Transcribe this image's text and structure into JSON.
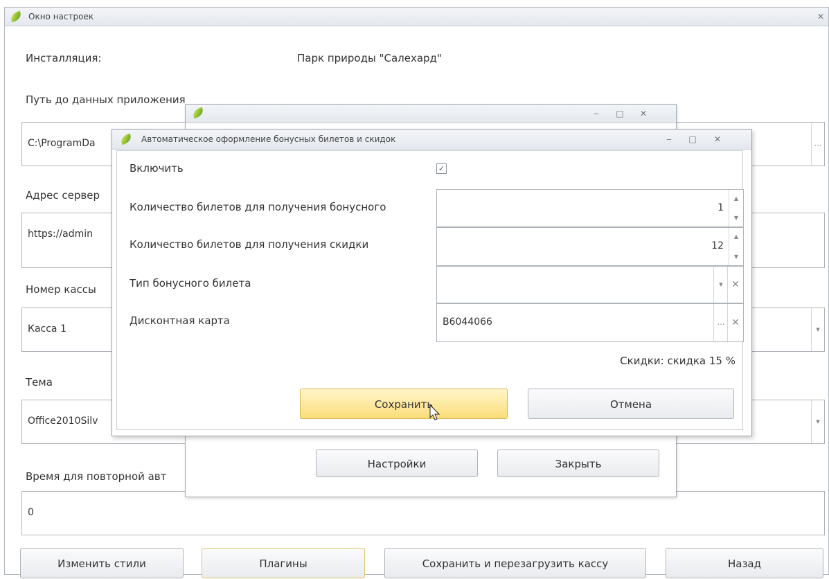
{
  "colors": {
    "accent": "#2b4fd6",
    "hot_button": "#fbdc7a",
    "border": "#aeb3ba"
  },
  "main": {
    "title": "Окно настроек",
    "installation_label": "Инсталляция:",
    "installation_value": "Парк природы \"Салехард\"",
    "path_label": "Путь до данных приложения",
    "path_value": "C:\\ProgramDa",
    "server_label": "Адрес сервер",
    "server_value": "https://admin",
    "register_label": "Номер кассы",
    "register_value": "Касса 1",
    "theme_label": "Тема",
    "theme_value": "Office2010Silv",
    "retry_label": "Время для повторной авт",
    "retry_value": "0",
    "buttons": {
      "styles": "Изменить стили",
      "plugins": "Плагины",
      "save_restart": "Сохранить и перезагрузить кассу",
      "back": "Назад"
    }
  },
  "plugins": {
    "buttons": {
      "settings": "Настройки",
      "close": "Закрыть"
    }
  },
  "dialog": {
    "title": "Автоматическое оформление бонусных билетов и скидок",
    "enable_label": "Включить",
    "enable_checked": true,
    "bonus_count_label": "Количество билетов для получения бонусного",
    "bonus_count_value": "1",
    "discount_count_label": "Количество билетов для получения скидки",
    "discount_count_value": "12",
    "ticket_type_label": "Тип бонусного билета",
    "ticket_type_value": "",
    "card_label": "Дисконтная карта",
    "card_value": "B6044066",
    "discount_info": "Скидки: скидка 15 %",
    "buttons": {
      "save": "Сохранить",
      "cancel": "Отмена"
    }
  },
  "icons": {
    "app": "leaf-icon",
    "close": "close-icon",
    "minimize": "minimize-icon",
    "maximize": "maximize-icon",
    "ellipsis": "ellipsis-icon",
    "dropdown": "chevron-down-icon",
    "clear": "clear-icon",
    "spin": "spin-arrows-icon"
  }
}
